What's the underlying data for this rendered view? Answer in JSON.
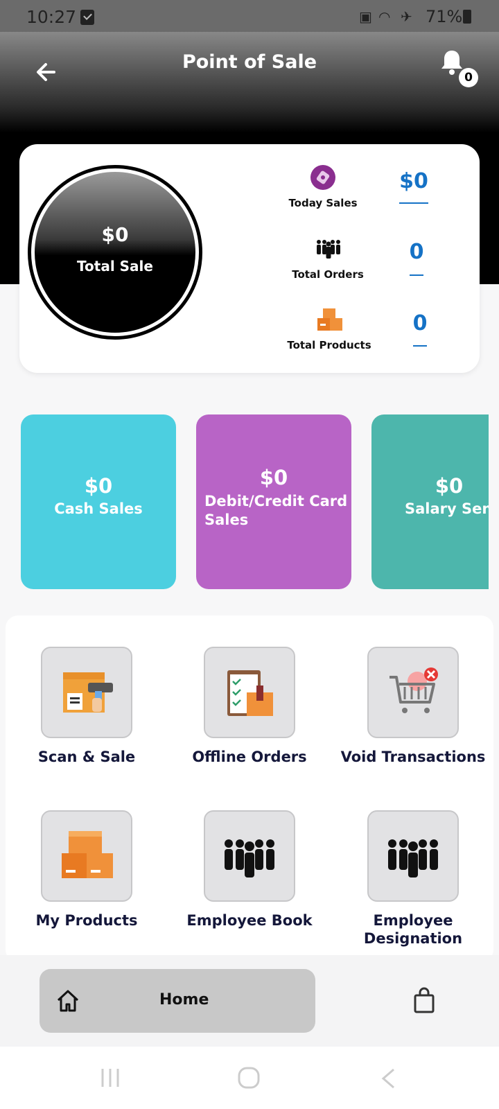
{
  "status_bar": {
    "time": "10:27",
    "battery": "71%"
  },
  "header": {
    "title": "Point of Sale",
    "notification_count": "0"
  },
  "summary": {
    "total_amount": "$0",
    "total_label": "Total Sale",
    "stats": [
      {
        "label": "Today Sales",
        "value": "$0",
        "icon": "sales-tag-icon"
      },
      {
        "label": "Total Orders",
        "value": "0",
        "icon": "people-group-icon"
      },
      {
        "label": "Total Products",
        "value": "0",
        "icon": "boxes-icon"
      }
    ]
  },
  "tiles": [
    {
      "amount": "$0",
      "label": "Cash Sales",
      "color": "#4ccfe0"
    },
    {
      "amount": "$0",
      "label": "Debit/Credit Card Sales",
      "label_line1": "Debit/Credit Card",
      "label_line2": "Sales",
      "color": "#b864c6"
    },
    {
      "amount": "$0",
      "label": "Salary Sent",
      "color": "#4db6ac"
    }
  ],
  "grid": [
    {
      "label": "Scan & Sale",
      "icon": "barcode-scanner-icon"
    },
    {
      "label": "Offline Orders",
      "icon": "clipboard-box-icon"
    },
    {
      "label": "Void Transactions",
      "icon": "cart-cancel-icon"
    },
    {
      "label": "My Products",
      "icon": "boxes-icon"
    },
    {
      "label": "Employee Book",
      "icon": "people-group-icon"
    },
    {
      "label": "Employee Designation",
      "label_line1": "Employee",
      "label_line2": "Designation",
      "icon": "people-group-icon"
    }
  ],
  "nav": {
    "home_label": "Home"
  },
  "colors": {
    "accent_blue": "#1572c6",
    "cyan": "#4ccfe0",
    "purple": "#b864c6",
    "teal": "#4db6ac"
  }
}
